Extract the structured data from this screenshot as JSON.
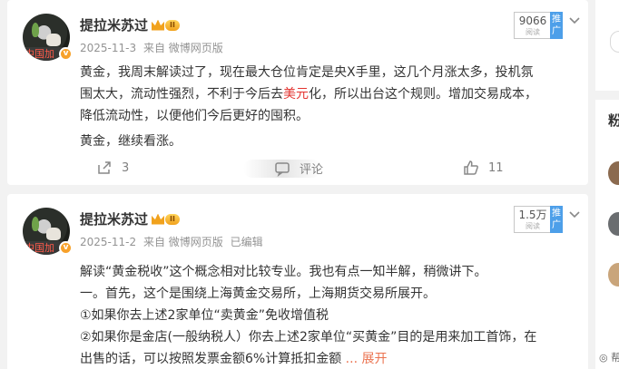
{
  "posts": [
    {
      "author": "提拉米苏过",
      "level": "II",
      "avatar_stamp": "中国加",
      "date": "2025-11-3",
      "source": "来自 微博网页版",
      "edited": "",
      "reads": "9066",
      "reads_label": "阅读",
      "rank_label": "推广",
      "lines": [
        [
          "黄金，我周末解读过了，现在最大仓位肯定是央X手里，这几个月涨太多，投机氛"
        ],
        [
          "围太大，流动性强烈，不利于今后去",
          "美元",
          "化，所以出台这个规则。增加交易成本，"
        ],
        [
          "降低流动性，以便他们今后更好的囤积。"
        ],
        [
          "黄金，继续看涨。"
        ]
      ],
      "repost_count": "3",
      "comment_label": "评论",
      "like_count": "11"
    },
    {
      "author": "提拉米苏过",
      "level": "II",
      "avatar_stamp": "中国加",
      "date": "2025-11-2",
      "source": "来自 微博网页版",
      "edited": "已编辑",
      "reads": "1.5万",
      "reads_label": "阅读",
      "rank_label": "推广",
      "lines": [
        "解读“黄金税收”这个概念相对比较专业。我也有点一知半解，稍微讲下。",
        "一。首先，这个是围绕上海黄金交易所，上海期货交易所展开。",
        "①如果你去上述2家单位“卖黄金”免收增值税",
        "②如果你是金店(一般纳税人）你去上述2家单位“买黄金”目的是用来加工首饰，在",
        "出售的话，可以按照发票金额6%计算抵扣金额"
      ],
      "more_label": "... 展开"
    }
  ],
  "sidebar": {
    "fan_label": "粉",
    "help_label": "帮"
  }
}
